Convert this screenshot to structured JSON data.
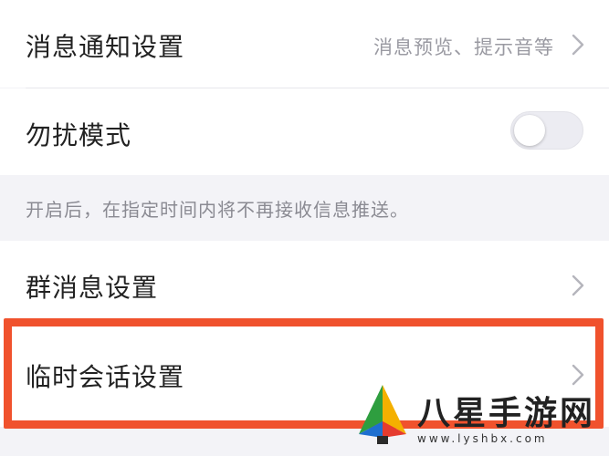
{
  "settings": {
    "message_notification": {
      "label": "消息通知设置",
      "value": "消息预览、提示音等"
    },
    "do_not_disturb": {
      "label": "勿扰模式",
      "enabled": false,
      "note": "开启后，在指定时间内将不再接收信息推送。"
    },
    "group_message": {
      "label": "群消息设置"
    },
    "temp_session": {
      "label": "临时会话设置"
    }
  },
  "watermark": {
    "title": "八星手游网",
    "url": "www.lyshbx.com"
  },
  "colors": {
    "highlight": "#f0522d",
    "background": "#f3f3f7",
    "row": "#ffffff"
  },
  "icons": [
    "chevron-right-icon",
    "toggle-switch",
    "site-logo-icon"
  ]
}
